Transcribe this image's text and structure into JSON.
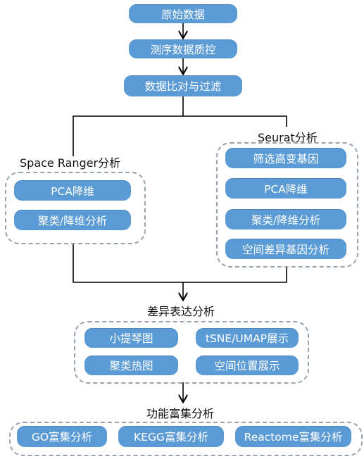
{
  "steps": {
    "raw_data": "原始数据",
    "sequencing_qc": "测序数据质控",
    "alignment_filter": "数据比对与过滤"
  },
  "space_ranger": {
    "title": "Space Ranger分析",
    "items": [
      "PCA降维",
      "聚类/降维分析"
    ]
  },
  "seurat": {
    "title": "Seurat分析",
    "items": [
      "筛选高变基因",
      "PCA降维",
      "聚类/降维分析",
      "空间差异基因分析"
    ]
  },
  "differential": {
    "title": "差异表达分析",
    "items": [
      "小提琴图",
      "tSNE/UMAP展示",
      "聚类热图",
      "空间位置展示"
    ]
  },
  "enrichment": {
    "title": "功能富集分析",
    "items": [
      "GO富集分析",
      "KEGG富集分析",
      "Reactome富集分析"
    ]
  },
  "colors": {
    "node": "#5b9bd5",
    "dashed_border": "#9aa3ad",
    "line": "#000000"
  }
}
